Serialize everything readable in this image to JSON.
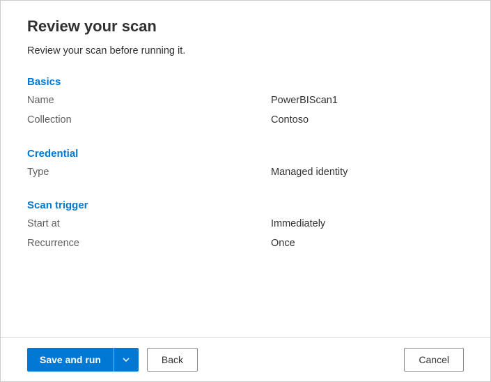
{
  "title": "Review your scan",
  "subtitle": "Review your scan before running it.",
  "sections": {
    "basics": {
      "heading": "Basics",
      "name_label": "Name",
      "name_value": "PowerBIScan1",
      "collection_label": "Collection",
      "collection_value": "Contoso"
    },
    "credential": {
      "heading": "Credential",
      "type_label": "Type",
      "type_value": "Managed identity"
    },
    "scan_trigger": {
      "heading": "Scan trigger",
      "start_label": "Start at",
      "start_value": "Immediately",
      "recurrence_label": "Recurrence",
      "recurrence_value": "Once"
    }
  },
  "footer": {
    "save_label": "Save and run",
    "back_label": "Back",
    "cancel_label": "Cancel"
  }
}
